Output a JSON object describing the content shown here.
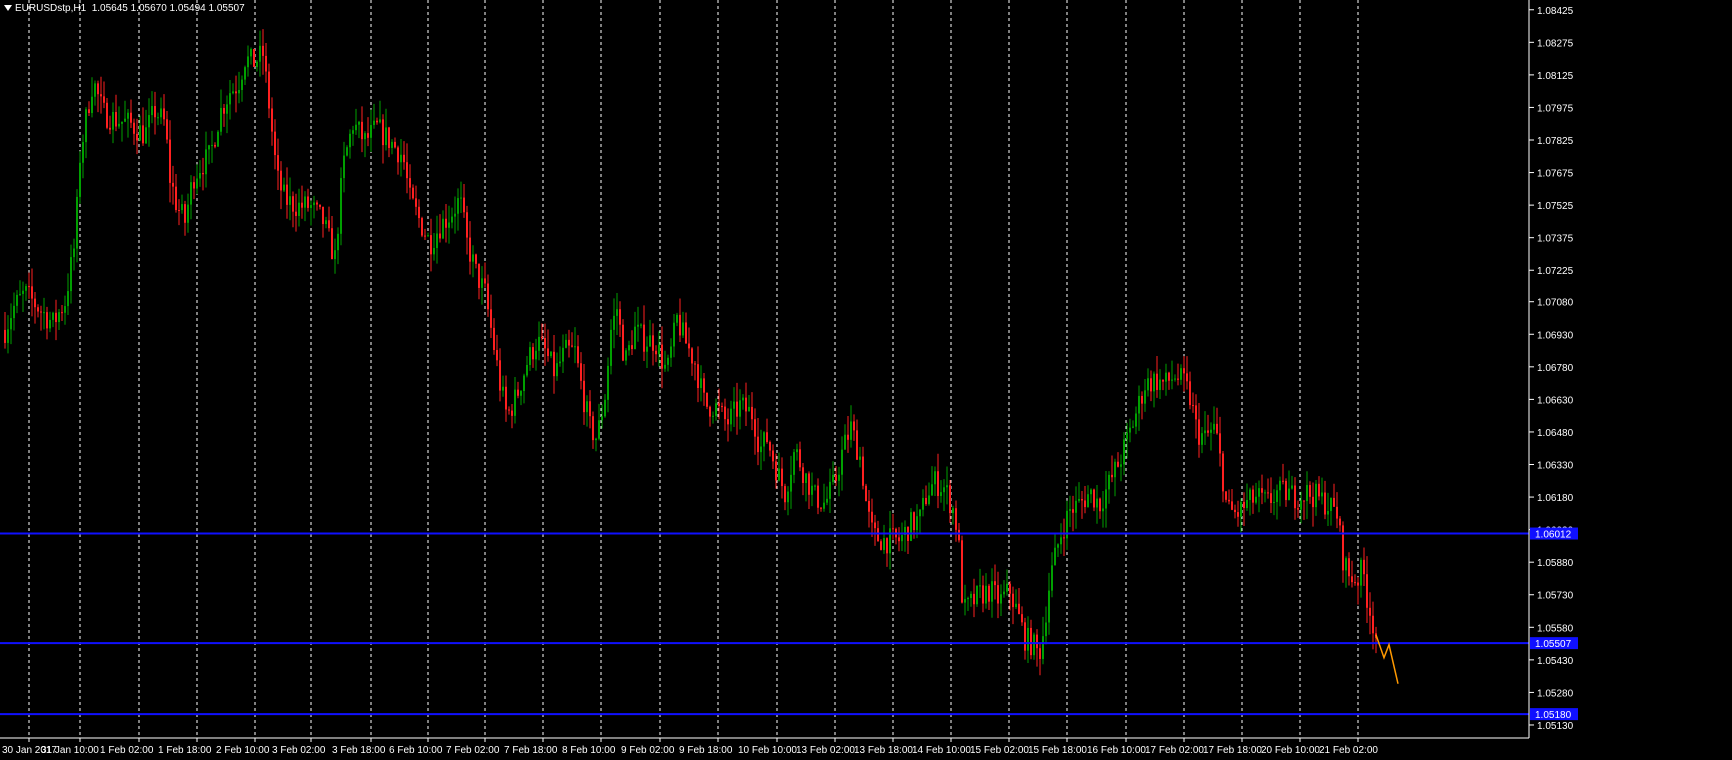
{
  "header": {
    "symbol": "EURUSDstp,H1",
    "ohlc": "1.05645 1.05670 1.05494 1.05507"
  },
  "colors": {
    "background": "#000000",
    "bull": "#00a000",
    "bear": "#ff2020",
    "level": "#1010ff",
    "forecast": "#ff9900",
    "grid": "#ffffff"
  },
  "chart_data": {
    "type": "candlestick",
    "title": "EURUSDstp,H1",
    "xlabel": "",
    "ylabel": "",
    "ylim": [
      1.0507,
      1.0847
    ],
    "grid": "vertical dotted",
    "y_ticks": [
      "1.08425",
      "1.08275",
      "1.08125",
      "1.07975",
      "1.07825",
      "1.07675",
      "1.07525",
      "1.07375",
      "1.07225",
      "1.07080",
      "1.06930",
      "1.06780",
      "1.06630",
      "1.06480",
      "1.06330",
      "1.06180",
      "1.06030",
      "1.05880",
      "1.05730",
      "1.05580",
      "1.05430",
      "1.05280",
      "1.05130"
    ],
    "x_ticks": [
      "30 Jan 2017",
      "31 Jan 10:00",
      "1 Feb 02:00",
      "1 Feb 18:00",
      "2 Feb 10:00",
      "3 Feb 02:00",
      "3 Feb 18:00",
      "6 Feb 10:00",
      "7 Feb 02:00",
      "7 Feb 18:00",
      "8 Feb 10:00",
      "9 Feb 02:00",
      "9 Feb 18:00",
      "10 Feb 10:00",
      "13 Feb 02:00",
      "13 Feb 18:00",
      "14 Feb 10:00",
      "15 Feb 02:00",
      "15 Feb 18:00",
      "16 Feb 10:00",
      "17 Feb 02:00",
      "17 Feb 18:00",
      "20 Feb 10:00",
      "21 Feb 02:00"
    ],
    "price_path": [
      [
        0,
        1.0695
      ],
      [
        8,
        1.0705
      ],
      [
        20,
        1.0712
      ],
      [
        34,
        1.0705
      ],
      [
        48,
        1.0698
      ],
      [
        60,
        1.0708
      ],
      [
        70,
        1.0735
      ],
      [
        75,
        1.0775
      ],
      [
        82,
        1.0795
      ],
      [
        88,
        1.081
      ],
      [
        98,
        1.0795
      ],
      [
        110,
        1.0792
      ],
      [
        125,
        1.079
      ],
      [
        140,
        1.0785
      ],
      [
        150,
        1.0796
      ],
      [
        160,
        1.079
      ],
      [
        165,
        1.0765
      ],
      [
        172,
        1.0752
      ],
      [
        180,
        1.0745
      ],
      [
        188,
        1.0765
      ],
      [
        194,
        1.077
      ],
      [
        205,
        1.0775
      ],
      [
        215,
        1.0795
      ],
      [
        225,
        1.0805
      ],
      [
        233,
        1.0808
      ],
      [
        240,
        1.082
      ],
      [
        248,
        1.0818
      ],
      [
        258,
        1.0822
      ],
      [
        265,
        1.0795
      ],
      [
        272,
        1.0765
      ],
      [
        280,
        1.0755
      ],
      [
        292,
        1.0752
      ],
      [
        305,
        1.0752
      ],
      [
        318,
        1.0745
      ],
      [
        330,
        1.0728
      ],
      [
        338,
        1.077
      ],
      [
        348,
        1.079
      ],
      [
        360,
        1.0782
      ],
      [
        372,
        1.0788
      ],
      [
        385,
        1.0782
      ],
      [
        398,
        1.0775
      ],
      [
        405,
        1.0755
      ],
      [
        415,
        1.0745
      ],
      [
        425,
        1.0735
      ],
      [
        435,
        1.0743
      ],
      [
        445,
        1.0748
      ],
      [
        455,
        1.0755
      ],
      [
        462,
        1.0735
      ],
      [
        472,
        1.072
      ],
      [
        480,
        1.0712
      ],
      [
        488,
        1.069
      ],
      [
        495,
        1.067
      ],
      [
        502,
        1.0655
      ],
      [
        512,
        1.0665
      ],
      [
        522,
        1.068
      ],
      [
        532,
        1.069
      ],
      [
        540,
        1.0685
      ],
      [
        550,
        1.0675
      ],
      [
        560,
        1.0685
      ],
      [
        570,
        1.0685
      ],
      [
        578,
        1.0665
      ],
      [
        585,
        1.065
      ],
      [
        592,
        1.0645
      ],
      [
        600,
        1.0665
      ],
      [
        606,
        1.0695
      ],
      [
        612,
        1.0705
      ],
      [
        620,
        1.068
      ],
      [
        630,
        1.0695
      ],
      [
        640,
        1.069
      ],
      [
        650,
        1.069
      ],
      [
        662,
        1.0675
      ],
      [
        672,
        1.07
      ],
      [
        680,
        1.069
      ],
      [
        690,
        1.068
      ],
      [
        700,
        1.066
      ],
      [
        710,
        1.066
      ],
      [
        722,
        1.0652
      ],
      [
        735,
        1.066
      ],
      [
        748,
        1.0656
      ],
      [
        755,
        1.064
      ],
      [
        762,
        1.0645
      ],
      [
        772,
        1.063
      ],
      [
        780,
        1.062
      ],
      [
        790,
        1.064
      ],
      [
        800,
        1.0628
      ],
      [
        810,
        1.0618
      ],
      [
        820,
        1.0615
      ],
      [
        830,
        1.0625
      ],
      [
        838,
        1.064
      ],
      [
        846,
        1.065
      ],
      [
        856,
        1.0635
      ],
      [
        862,
        1.0612
      ],
      [
        868,
        1.06
      ],
      [
        880,
        1.0598
      ],
      [
        895,
        1.0598
      ],
      [
        905,
        1.0605
      ],
      [
        915,
        1.0608
      ],
      [
        922,
        1.062
      ],
      [
        930,
        1.0625
      ],
      [
        940,
        1.0622
      ],
      [
        950,
        1.061
      ],
      [
        955,
        1.059
      ],
      [
        958,
        1.0565
      ],
      [
        964,
        1.0568
      ],
      [
        975,
        1.0573
      ],
      [
        985,
        1.0575
      ],
      [
        995,
        1.057
      ],
      [
        1005,
        1.0575
      ],
      [
        1012,
        1.0565
      ],
      [
        1020,
        1.0553
      ],
      [
        1028,
        1.055
      ],
      [
        1034,
        1.0545
      ],
      [
        1038,
        1.0555
      ],
      [
        1045,
        1.058
      ],
      [
        1055,
        1.06
      ],
      [
        1065,
        1.0612
      ],
      [
        1075,
        1.0615
      ],
      [
        1085,
        1.062
      ],
      [
        1095,
        1.0615
      ],
      [
        1105,
        1.0625
      ],
      [
        1115,
        1.0635
      ],
      [
        1125,
        1.0648
      ],
      [
        1132,
        1.0658
      ],
      [
        1140,
        1.067
      ],
      [
        1150,
        1.0672
      ],
      [
        1160,
        1.067
      ],
      [
        1170,
        1.0674
      ],
      [
        1180,
        1.067
      ],
      [
        1186,
        1.0662
      ],
      [
        1192,
        1.0648
      ],
      [
        1200,
        1.0645
      ],
      [
        1210,
        1.065
      ],
      [
        1217,
        1.063
      ],
      [
        1222,
        1.0612
      ],
      [
        1232,
        1.061
      ],
      [
        1242,
        1.0615
      ],
      [
        1252,
        1.0618
      ],
      [
        1262,
        1.0615
      ],
      [
        1272,
        1.062
      ],
      [
        1282,
        1.062
      ],
      [
        1292,
        1.0618
      ],
      [
        1302,
        1.062
      ],
      [
        1312,
        1.0618
      ],
      [
        1322,
        1.0615
      ],
      [
        1332,
        1.061
      ],
      [
        1338,
        1.059
      ],
      [
        1344,
        1.0582
      ],
      [
        1352,
        1.058
      ],
      [
        1358,
        1.0585
      ],
      [
        1362,
        1.0572
      ],
      [
        1368,
        1.056
      ],
      [
        1372,
        1.0552
      ]
    ],
    "horizontal_levels": [
      {
        "price": 1.06012,
        "label": "1.06012"
      },
      {
        "price": 1.05507,
        "label": "1.05507"
      },
      {
        "price": 1.0518,
        "label": "1.05180"
      }
    ],
    "forecast_path": [
      [
        1372,
        1.05545
      ],
      [
        1380,
        1.0544
      ],
      [
        1385,
        1.055
      ],
      [
        1394,
        1.0532
      ]
    ],
    "x_tick_index": [
      8,
      59,
      118,
      176,
      234,
      290,
      350,
      407,
      464,
      522,
      580,
      639,
      697,
      756,
      814,
      872,
      930,
      988,
      1046,
      1105,
      1163,
      1221,
      1279,
      1337
    ]
  }
}
